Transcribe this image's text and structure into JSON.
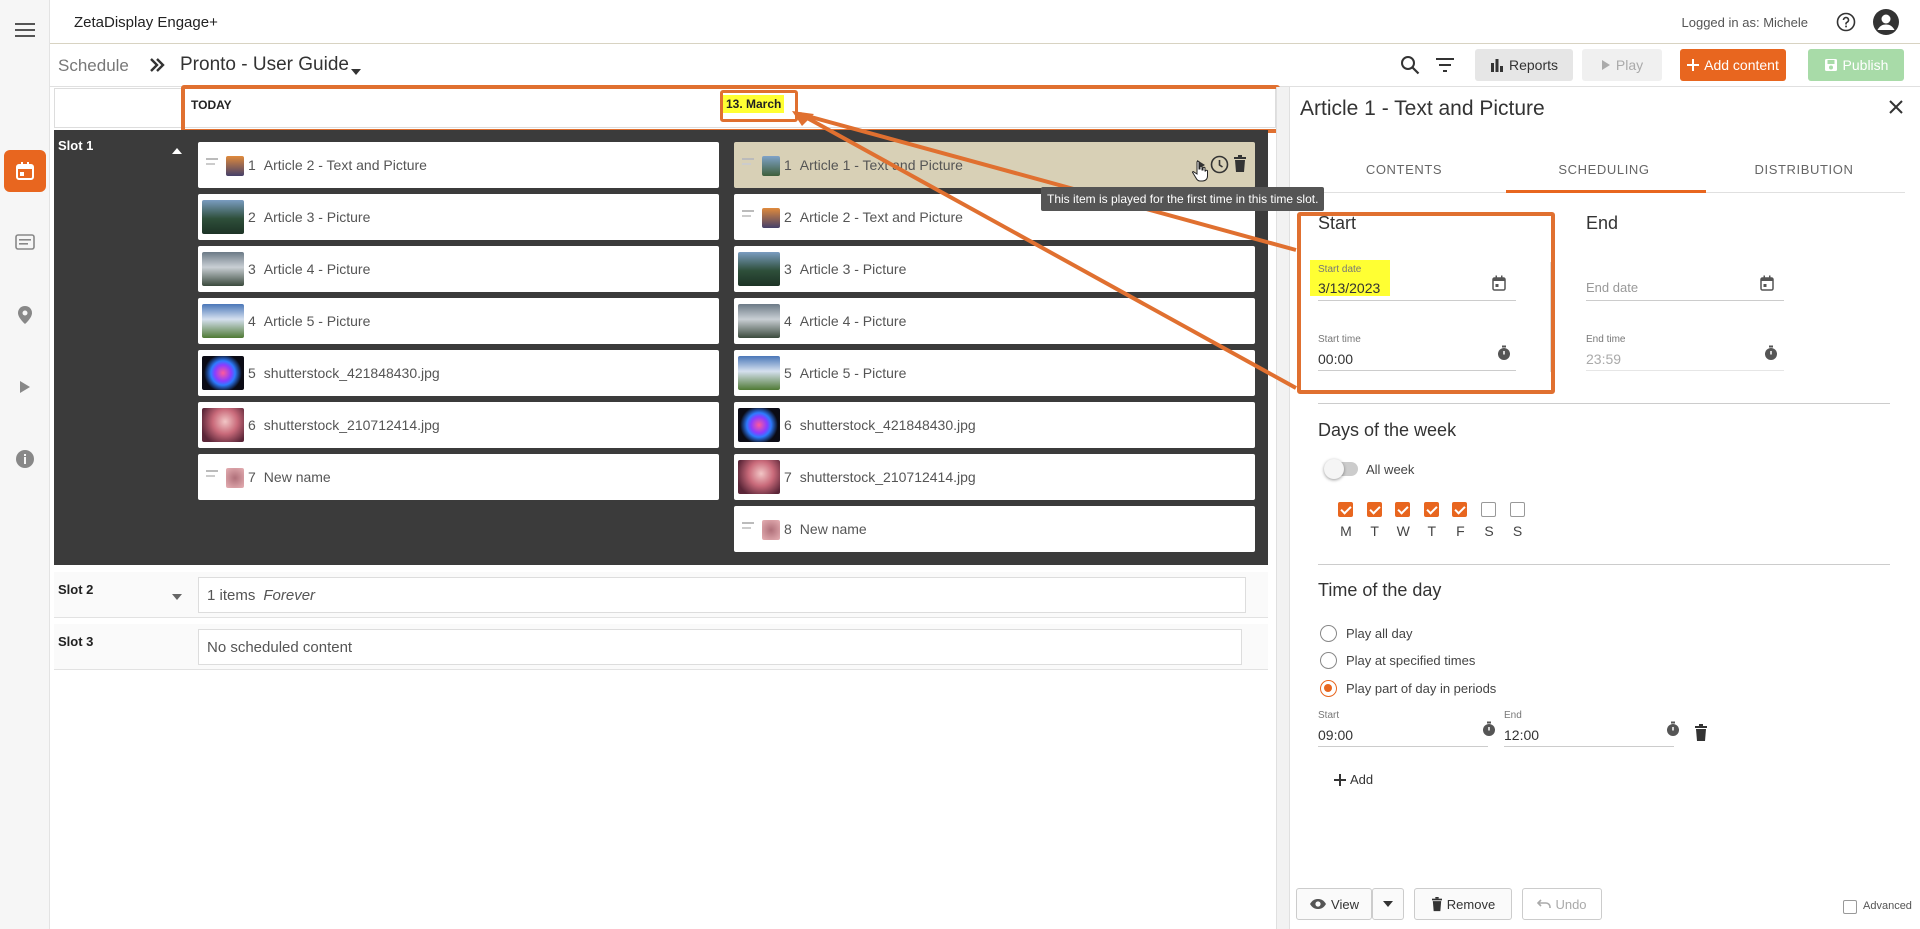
{
  "app": {
    "brand": "ZetaDisplay Engage+",
    "logged_in": "Logged in as: Michele"
  },
  "breadcrumb": {
    "root": "Schedule",
    "current": "Pronto - User Guide"
  },
  "toolbar": {
    "reports": "Reports",
    "play": "Play",
    "add_content": "Add content",
    "publish": "Publish"
  },
  "timeline": {
    "today_label": "TODAY",
    "date_label": "13. March"
  },
  "slots": [
    {
      "name": "Slot 1"
    },
    {
      "name": "Slot 2",
      "summary_count": "1 items",
      "summary_period": "Forever"
    },
    {
      "name": "Slot 3",
      "summary": "No scheduled content"
    }
  ],
  "today_items": [
    {
      "n": "1",
      "title": "Article 2 - Text and Picture"
    },
    {
      "n": "2",
      "title": "Article 3 - Picture"
    },
    {
      "n": "3",
      "title": "Article 4 - Picture"
    },
    {
      "n": "4",
      "title": "Article 5 - Picture"
    },
    {
      "n": "5",
      "title": "shutterstock_421848430.jpg"
    },
    {
      "n": "6",
      "title": "shutterstock_210712414.jpg"
    },
    {
      "n": "7",
      "title": "New name"
    }
  ],
  "march_items": [
    {
      "n": "1",
      "title": "Article 1 - Text and Picture"
    },
    {
      "n": "2",
      "title": "Article 2 - Text and Picture"
    },
    {
      "n": "3",
      "title": "Article 3 - Picture"
    },
    {
      "n": "4",
      "title": "Article 4 - Picture"
    },
    {
      "n": "5",
      "title": "Article 5 - Picture"
    },
    {
      "n": "6",
      "title": "shutterstock_421848430.jpg"
    },
    {
      "n": "7",
      "title": "shutterstock_210712414.jpg"
    },
    {
      "n": "8",
      "title": "New name"
    }
  ],
  "tooltip": "This item is played for the first time in this time slot.",
  "panel": {
    "title": "Article 1 - Text and Picture",
    "tabs": [
      "CONTENTS",
      "SCHEDULING",
      "DISTRIBUTION"
    ],
    "start": {
      "heading": "Start",
      "date_label": "Start date",
      "date_value": "3/13/2023",
      "time_label": "Start time",
      "time_value": "00:00"
    },
    "end": {
      "heading": "End",
      "date_placeholder": "End date",
      "time_label": "End time",
      "time_value": "23:59"
    },
    "days": {
      "heading": "Days of the week",
      "all_week": "All week",
      "letters": [
        "M",
        "T",
        "W",
        "T",
        "F",
        "S",
        "S"
      ],
      "checked": [
        true,
        true,
        true,
        true,
        true,
        false,
        false
      ]
    },
    "tod": {
      "heading": "Time of the day",
      "options": [
        "Play all day",
        "Play at specified times",
        "Play part of day in periods"
      ],
      "selected": 2,
      "period": {
        "start_label": "Start",
        "start_value": "09:00",
        "end_label": "End",
        "end_value": "12:00"
      },
      "add": "Add"
    },
    "footer": {
      "view": "View",
      "remove": "Remove",
      "undo": "Undo",
      "advanced": "Advanced"
    }
  },
  "colors": {
    "accent": "#e8661f",
    "highlight": "#ffff33",
    "publish": "#a8dba8",
    "slot_bg": "#3b3b3b"
  }
}
